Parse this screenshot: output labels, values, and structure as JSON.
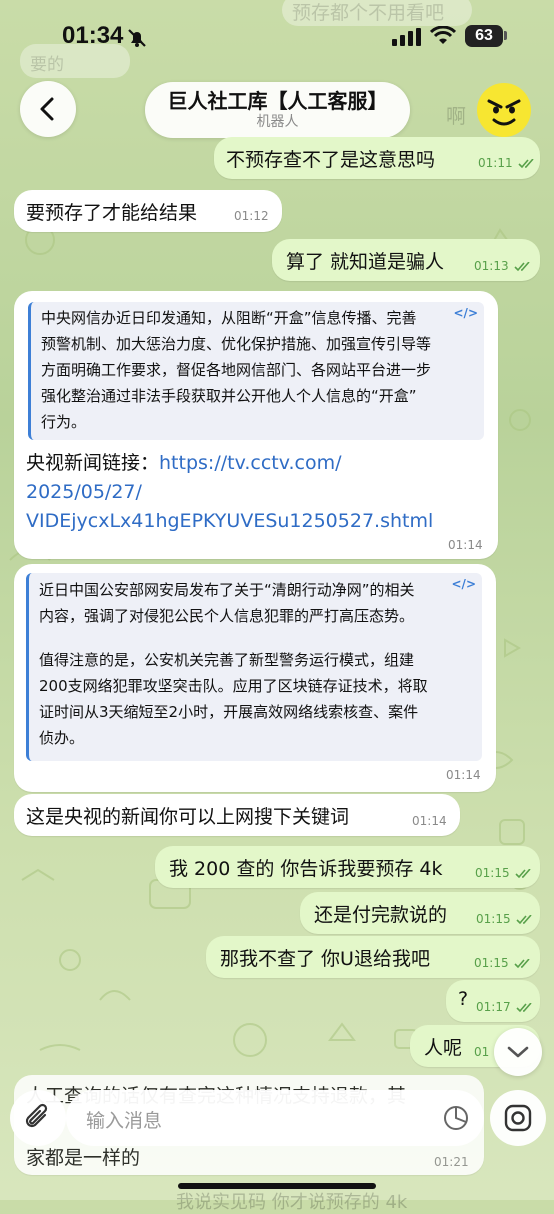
{
  "status_bar": {
    "time": "01:34",
    "battery": "63"
  },
  "header": {
    "title": "巨人社工库【人工客服】",
    "subtitle": "机器人"
  },
  "messages": [
    {
      "text": "不预存查不了是这意思吗",
      "time": "01:11"
    },
    {
      "text": "要预存了才能给结果",
      "time": "01:12"
    },
    {
      "text": "算了 就知道是骗人",
      "time": "01:13"
    },
    {
      "quote_lines": [
        "中央网信办近日印发通知，从阻断“开盒”信息传播、完善",
        "预警机制、加大惩治力度、优化保护措施、加强宣传引导等",
        "方面明确工作要求，督促各地网信部门、各网站平台进一步",
        "强化整治通过非法手段获取并公开他人个人信息的“开盒”",
        "行为。"
      ],
      "link_label": "央视新闻链接：",
      "link_lines": [
        "https://tv.cctv.com/",
        "2025/05/27/",
        "VIDEjycxLx41hgEPKYUVESu1250527.shtml"
      ],
      "time": "01:14"
    },
    {
      "quote_lines_1": [
        "近日中国公安部网安局发布了关于“清朗行动净网”的相关",
        "内容，强调了对侵犯公民个人信息犯罪的严打高压态势。"
      ],
      "quote_lines_2": [
        "值得注意的是，公安机关完善了新型警务运行模式，组建",
        "200支网络犯罪攻坚突击队。应用了区块链存证技术，将取",
        "证时间从3天缩短至2小时，开展高效网络线索核查、案件",
        "侦办。"
      ],
      "time": "01:14"
    },
    {
      "text": "这是央视的新闻你可以上网搜下关键词",
      "time": "01:14"
    },
    {
      "text": "我 200 查的 你告诉我要预存 4k",
      "time": "01:15"
    },
    {
      "text": "还是付完款说的",
      "time": "01:15"
    },
    {
      "text": "那我不查了 你U退给我吧",
      "time": "01:15"
    },
    {
      "text": "?",
      "time": "01:17"
    },
    {
      "text": "人呢",
      "time": "01"
    },
    {
      "text_1": "人工查询的话仅有查完这种情况支持退款，其",
      "text_2": "家都是一样的",
      "time": "01:21"
    }
  ],
  "input": {
    "placeholder": "输入消息"
  },
  "background_ghost": {
    "top_text": "预存都个不用看吧",
    "top_left": "要的",
    "top_right": "啊",
    "bottom": "我说实见码 你才说预存的 4k"
  }
}
